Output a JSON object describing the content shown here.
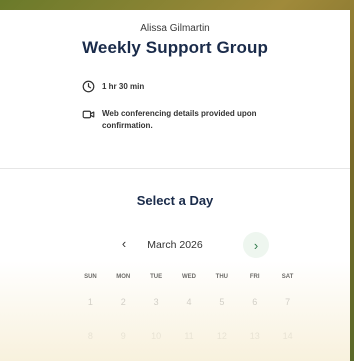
{
  "event": {
    "host": "Alissa Gilmartin",
    "title": "Weekly Support Group",
    "duration": "1 hr 30 min",
    "conferencing": "Web conferencing details provided upon confirmation."
  },
  "calendar": {
    "heading": "Select a Day",
    "month_label": "March 2026",
    "prev_icon": "chevron-left",
    "next_icon": "chevron-right",
    "weekdays": [
      "SUN",
      "MON",
      "TUE",
      "WED",
      "THU",
      "FRI",
      "SAT"
    ],
    "rows": [
      [
        "1",
        "2",
        "3",
        "4",
        "5",
        "6",
        "7"
      ],
      [
        "8",
        "9",
        "10",
        "11",
        "12",
        "13",
        "14"
      ]
    ]
  },
  "colors": {
    "title": "#1a2b4a",
    "next_button_bg": "#eef6ef",
    "next_button_fg": "#2f7a4a",
    "day_disabled": "#b7b7b7"
  }
}
